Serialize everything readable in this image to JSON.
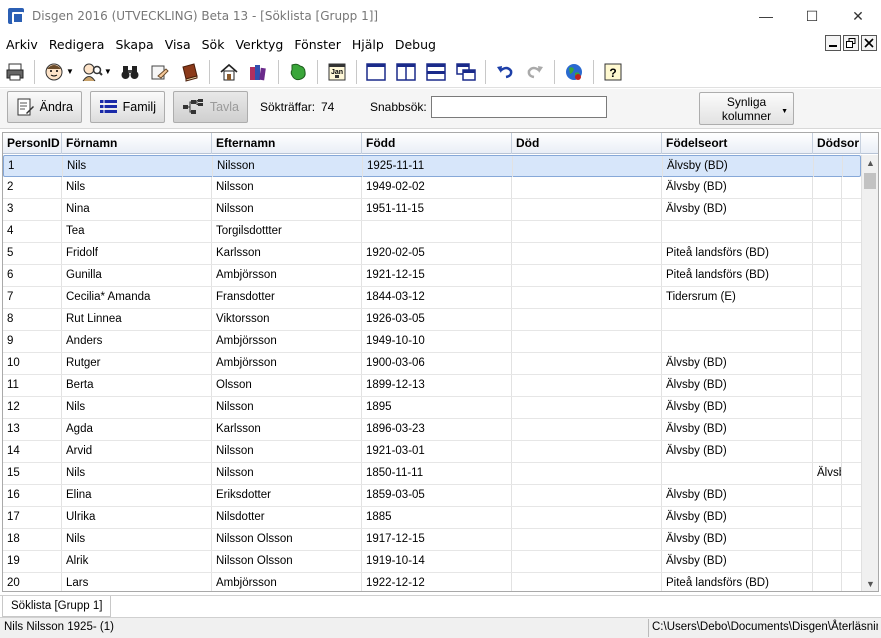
{
  "window": {
    "title": "Disgen 2016 (UTVECKLING) Beta 13 - [Söklista [Grupp 1]]",
    "minimize": "—",
    "maximize": "☐",
    "close": "✕"
  },
  "menu": [
    "Arkiv",
    "Redigera",
    "Skapa",
    "Visa",
    "Sök",
    "Verktyg",
    "Fönster",
    "Hjälp",
    "Debug"
  ],
  "toolbar_icons": [
    "print-icon",
    "person-icon",
    "search-person-icon",
    "binoculars-icon",
    "hand-pointing-icon",
    "book-icon",
    "home-icon",
    "books-icon",
    "map-icon",
    "calendar-icon",
    "single-panel-icon",
    "two-panel-icon",
    "split-horizontal-icon",
    "cascade-windows-icon",
    "undo-icon",
    "redo-icon",
    "globe-icon",
    "help-icon"
  ],
  "calendar_label": "Jan",
  "help_label": "?",
  "actions": {
    "edit": "Ändra",
    "family": "Familj",
    "tree": "Tavla",
    "hits_label": "Sökträffar:",
    "hits_count": "74",
    "quick_search_label": "Snabbsök:",
    "quick_search_value": "",
    "visible_columns_line1": "Synliga",
    "visible_columns_line2": "kolumner"
  },
  "columns": [
    "PersonID",
    "Förnamn",
    "Efternamn",
    "Född",
    "Död",
    "Födelseort",
    "Dödsor"
  ],
  "rows": [
    [
      "1",
      "Nils",
      "Nilsson",
      "1925-11-11",
      "",
      "Älvsby (BD)",
      ""
    ],
    [
      "2",
      "Nils",
      "Nilsson",
      "1949-02-02",
      "",
      "Älvsby (BD)",
      ""
    ],
    [
      "3",
      "Nina",
      "Nilsson",
      "1951-11-15",
      "",
      "Älvsby (BD)",
      ""
    ],
    [
      "4",
      "Tea",
      "Torgilsdottter",
      "",
      "",
      "",
      ""
    ],
    [
      "5",
      "Fridolf",
      "Karlsson",
      "1920-02-05",
      "",
      "Piteå landsförs (BD)",
      ""
    ],
    [
      "6",
      "Gunilla",
      "Ambjörsson",
      "1921-12-15",
      "",
      "Piteå landsförs (BD)",
      ""
    ],
    [
      "7",
      "Cecilia* Amanda",
      "Fransdotter",
      "1844-03-12",
      "",
      "Tidersrum (E)",
      ""
    ],
    [
      "8",
      "Rut Linnea",
      "Viktorsson",
      "1926-03-05",
      "",
      "",
      ""
    ],
    [
      "9",
      "Anders",
      "Ambjörsson",
      "1949-10-10",
      "",
      "",
      ""
    ],
    [
      "10",
      "Rutger",
      "Ambjörsson",
      "1900-03-06",
      "",
      "Älvsby (BD)",
      ""
    ],
    [
      "11",
      "Berta",
      "Olsson",
      "1899-12-13",
      "",
      "Älvsby (BD)",
      ""
    ],
    [
      "12",
      "Nils",
      "Nilsson",
      "1895",
      "",
      "Älvsby (BD)",
      ""
    ],
    [
      "13",
      "Agda",
      "Karlsson",
      "1896-03-23",
      "",
      "Älvsby (BD)",
      ""
    ],
    [
      "14",
      "Arvid",
      "Nilsson",
      "1921-03-01",
      "",
      "Älvsby (BD)",
      ""
    ],
    [
      "15",
      "Nils",
      "Nilsson",
      "1850-11-11",
      "",
      "",
      "Älvsby"
    ],
    [
      "16",
      "Elina",
      "Eriksdotter",
      "1859-03-05",
      "",
      "Älvsby (BD)",
      ""
    ],
    [
      "17",
      "Ulrika",
      "Nilsdotter",
      "1885",
      "",
      "Älvsby (BD)",
      ""
    ],
    [
      "18",
      "Nils",
      "Nilsson Olsson",
      "1917-12-15",
      "",
      "Älvsby (BD)",
      ""
    ],
    [
      "19",
      "Alrik",
      "Nilsson Olsson",
      "1919-10-14",
      "",
      "Älvsby (BD)",
      ""
    ],
    [
      "20",
      "Lars",
      "Ambjörsson",
      "1922-12-12",
      "",
      "Piteå landsförs (BD)",
      ""
    ]
  ],
  "selected_row": 0,
  "tab": "Söklista [Grupp 1]",
  "status": {
    "left": "Nils Nilsson 1925- (1)",
    "right": "C:\\Users\\Debo\\Documents\\Disgen\\Återläsning"
  },
  "colors": {
    "selection": "#d7e6fa",
    "accent": "#2b5fb4"
  }
}
